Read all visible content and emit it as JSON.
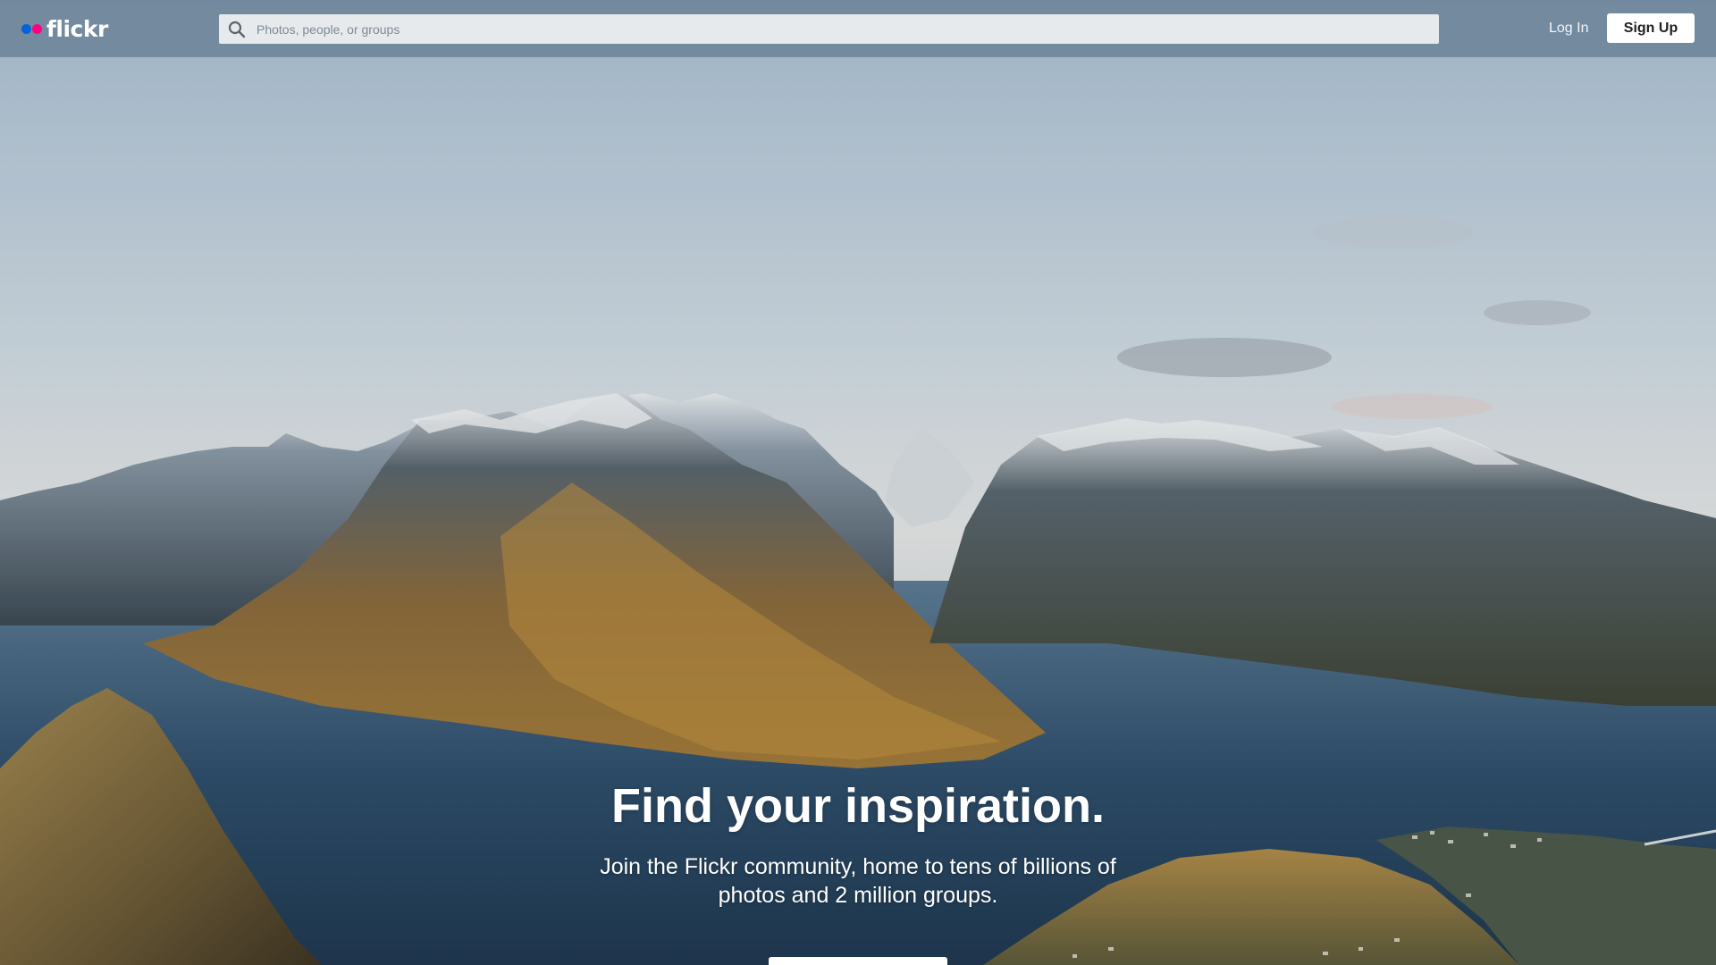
{
  "header": {
    "logo_text": "flickr",
    "search_placeholder": "Photos, people, or groups",
    "login_label": "Log In",
    "signup_label": "Sign Up"
  },
  "hero": {
    "headline": "Find your inspiration.",
    "subtext": "Join the Flickr community, home to tens of billions of photos and 2 million groups.",
    "cta_label": ""
  },
  "colors": {
    "brand_blue": "#0063dc",
    "brand_pink": "#ff0084",
    "topbar": "#6a8096"
  },
  "icons": {
    "search": "search-icon"
  }
}
